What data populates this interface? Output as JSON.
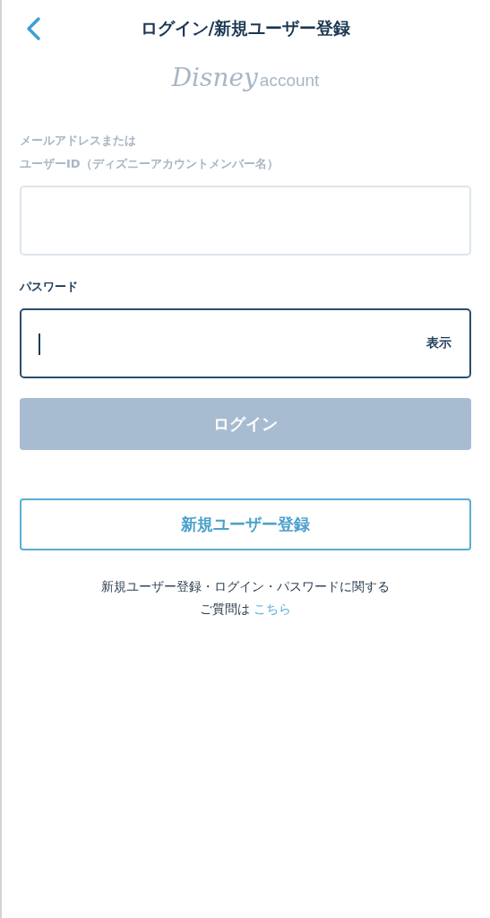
{
  "header": {
    "title": "ログイン/新規ユーザー登録"
  },
  "logo": {
    "brand": "Disney",
    "suffix": "account"
  },
  "fields": [
    {
      "label_lines": [
        "メールアドレスまたは",
        "ユーザーID（ディズニーアカウントメンバー名）"
      ],
      "focused": false
    },
    {
      "label_lines": [
        "パスワード"
      ],
      "focused": true,
      "toggle": "表示"
    }
  ],
  "login_button": {
    "label": "ログイン",
    "disabled": true
  },
  "register_button": {
    "label": "新規ユーザー登録"
  },
  "help": {
    "line_1": "新規ユーザー登録・ログイン・パスワードに関する",
    "line_2": "ご質問は",
    "link": "こちら"
  }
}
